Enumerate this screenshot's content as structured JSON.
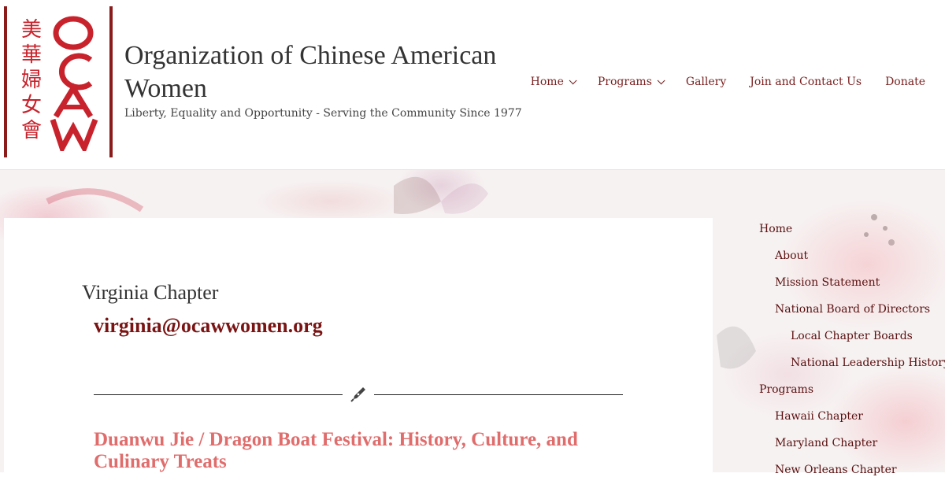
{
  "header": {
    "logo_chinese": [
      "美",
      "華",
      "婦",
      "女",
      "會"
    ],
    "logo_letters": "OCAW",
    "site_title": "Organization of Chinese American Women",
    "tagline": "Liberty, Equality and Opportunity - Serving the Community Since 1977"
  },
  "nav": {
    "home": "Home",
    "programs": "Programs",
    "gallery": "Gallery",
    "join": "Join and Contact Us",
    "donate": "Donate"
  },
  "main": {
    "chapter_title": "Virginia Chapter",
    "email": "virginia@ocawwomen.org",
    "post_title": "Duanwu Jie / Dragon Boat Festival: History, Culture, and Culinary Treats"
  },
  "sidebar": {
    "items": [
      {
        "label": "Home"
      },
      {
        "label": "About"
      },
      {
        "label": "Mission Statement"
      },
      {
        "label": "National Board of Directors"
      },
      {
        "label": "Local Chapter Boards"
      },
      {
        "label": "National Leadership History"
      },
      {
        "label": "Programs"
      },
      {
        "label": "Hawaii Chapter"
      },
      {
        "label": "Maryland Chapter"
      },
      {
        "label": "New Orleans Chapter"
      }
    ]
  },
  "colors": {
    "brand_red": "#c8232c",
    "dark_red": "#7a1414",
    "post_title": "#e06c6c"
  }
}
